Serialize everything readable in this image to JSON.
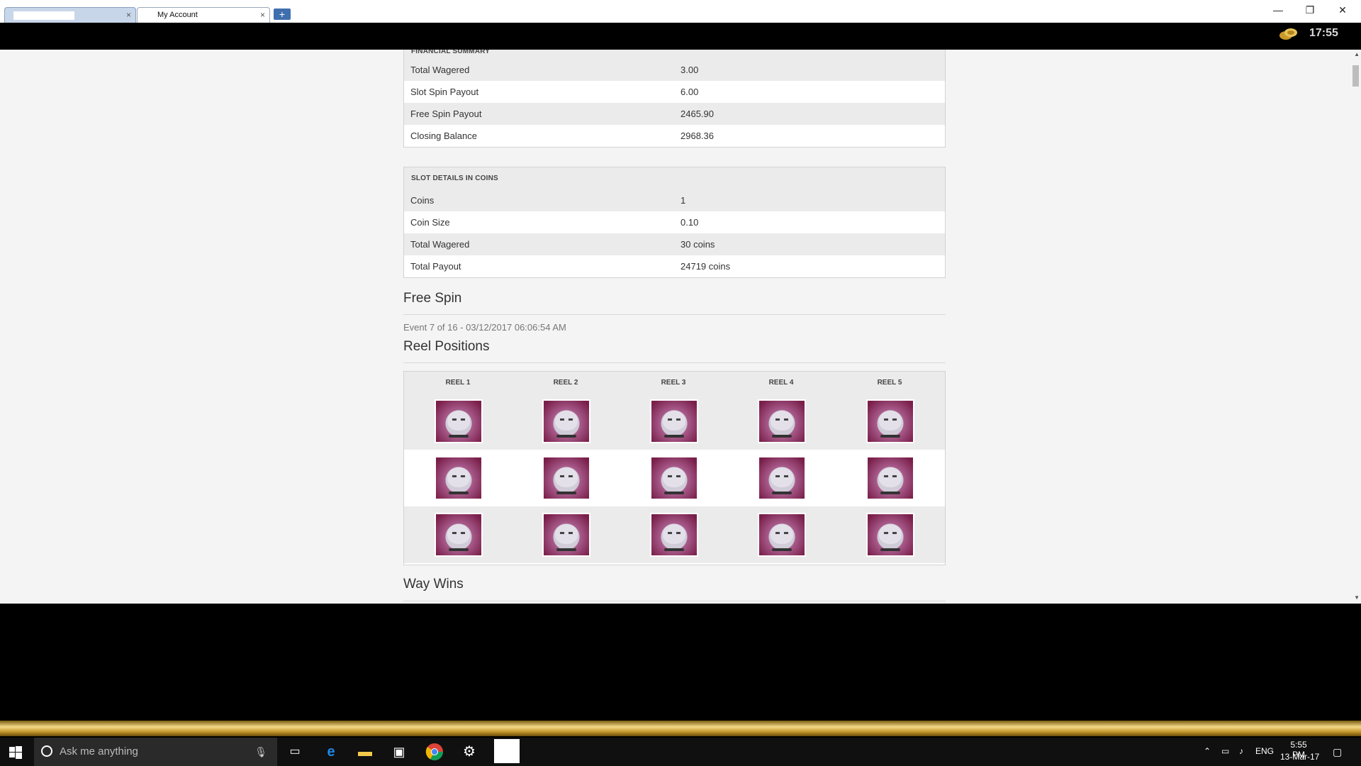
{
  "browser": {
    "tabs": [
      {
        "label": ""
      },
      {
        "label": "My Account"
      }
    ],
    "new_tab_label": "+",
    "tab_close_label": "×",
    "window_controls": {
      "minimize": "—",
      "restore": "❐",
      "close": "✕"
    }
  },
  "app_header": {
    "clock": "17:55",
    "coin_icon": "gold-coins-icon"
  },
  "financial_summary": {
    "heading": "FINANCIAL SUMMARY",
    "rows": [
      {
        "label": "Total Wagered",
        "value": "3.00"
      },
      {
        "label": "Slot Spin Payout",
        "value": "6.00"
      },
      {
        "label": "Free Spin Payout",
        "value": "2465.90"
      },
      {
        "label": "Closing Balance",
        "value": "2968.36"
      }
    ]
  },
  "slot_details": {
    "heading": "SLOT DETAILS IN COINS",
    "rows": [
      {
        "label": "Coins",
        "value": "1"
      },
      {
        "label": "Coin Size",
        "value": "0.10"
      },
      {
        "label": "Total Wagered",
        "value": "30 coins"
      },
      {
        "label": "Total Payout",
        "value": "24719 coins"
      }
    ]
  },
  "free_spin": {
    "title": "Free Spin",
    "event": "Event 7 of 16 - 03/12/2017 06:06:54 AM"
  },
  "reel_positions": {
    "title": "Reel Positions",
    "headers": [
      "REEL 1",
      "REEL 2",
      "REEL 3",
      "REEL 4",
      "REEL 5"
    ],
    "symbol": "persian-cat-symbol",
    "rows": 3
  },
  "way_wins": {
    "title": "Way Wins"
  },
  "taskbar": {
    "search_placeholder": "Ask me anything",
    "apps": [
      "task-view-icon",
      "edge-icon",
      "file-explorer-icon",
      "store-icon",
      "chrome-icon",
      "settings-icon",
      "active-app"
    ],
    "language": "ENG",
    "time": "5:55 PM",
    "date": "13-Mar-17"
  },
  "colors": {
    "row_alt": "#ebebeb",
    "page_bg": "#f4f4f4",
    "gold": "#d4a940"
  }
}
